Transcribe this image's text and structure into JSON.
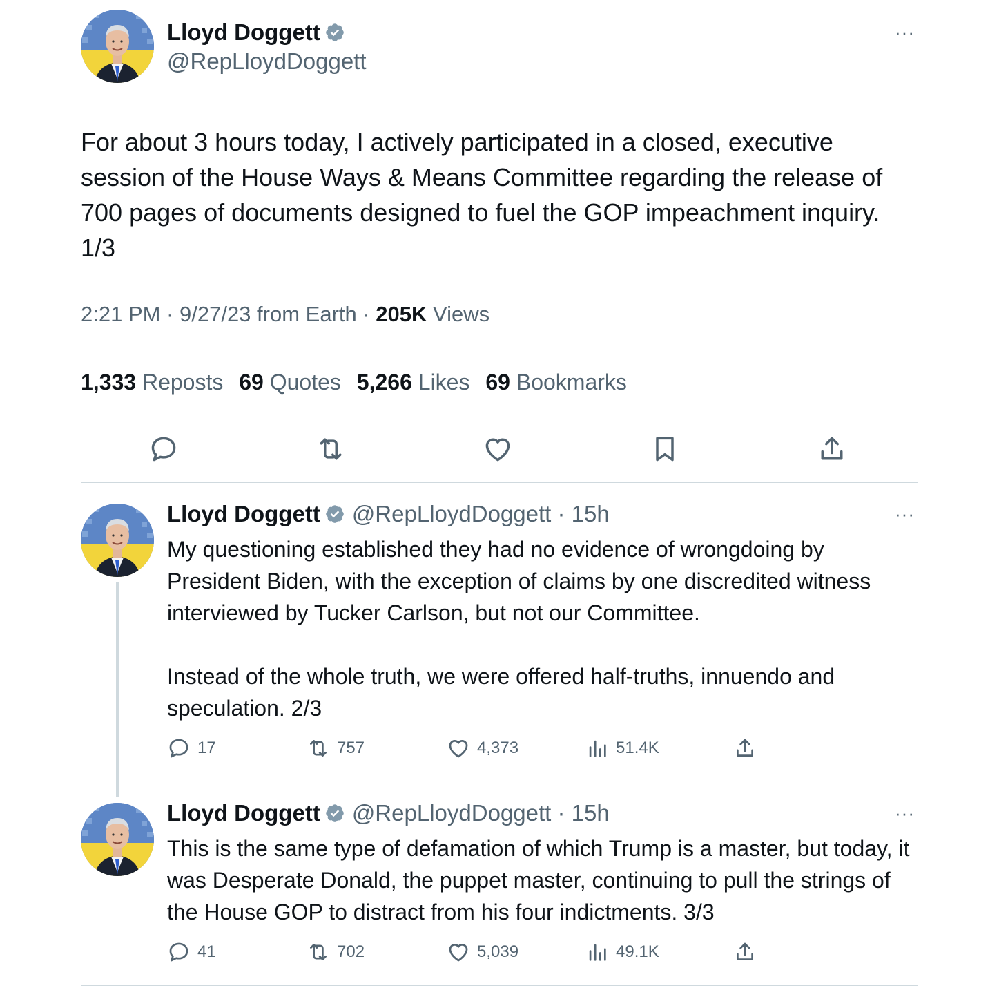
{
  "main_tweet": {
    "author_name": "Lloyd Doggett",
    "handle": "@RepLloydDoggett",
    "more_label": "···",
    "text": "For about 3 hours today, I actively participated in a closed, executive session of the House Ways & Means Committee regarding the release of 700 pages of documents designed to fuel the GOP impeachment inquiry. 1/3",
    "timestamp": "2:21 PM · 9/27/23 from Earth · ",
    "views_count": "205K",
    "views_label": " Views",
    "stats": {
      "reposts_count": "1,333",
      "reposts_label": " Reposts",
      "quotes_count": "69",
      "quotes_label": " Quotes",
      "likes_count": "5,266",
      "likes_label": " Likes",
      "bookmarks_count": "69",
      "bookmarks_label": " Bookmarks"
    },
    "action_icons": [
      "reply-icon",
      "repost-icon",
      "like-icon",
      "bookmark-icon",
      "share-icon"
    ]
  },
  "replies": [
    {
      "author_name": "Lloyd Doggett",
      "handle_time": "@RepLloydDoggett · 15h",
      "more_label": "···",
      "paragraph1": "My questioning established they had no evidence of wrongdoing by President Biden, with the exception of claims by one discredited witness interviewed by Tucker Carlson, but not our Committee.",
      "paragraph2": "Instead of the whole truth, we were offered half-truths, innuendo and speculation. 2/3",
      "replies_count": "17",
      "reposts_count": "757",
      "likes_count": "4,373",
      "views_count": "51.4K"
    },
    {
      "author_name": "Lloyd Doggett",
      "handle_time": "@RepLloydDoggett · 15h",
      "more_label": "···",
      "paragraph1": "This is the same type of defamation of which Trump is a master, but today, it was Desperate Donald, the puppet master, continuing to pull the strings of the House GOP to distract from his four indictments. 3/3",
      "replies_count": "41",
      "reposts_count": "702",
      "likes_count": "5,039",
      "views_count": "49.1K"
    }
  ],
  "colors": {
    "text_primary": "#0f1419",
    "text_secondary": "#536471",
    "divider": "#cfd9de",
    "verified_badge": "#829aab"
  }
}
